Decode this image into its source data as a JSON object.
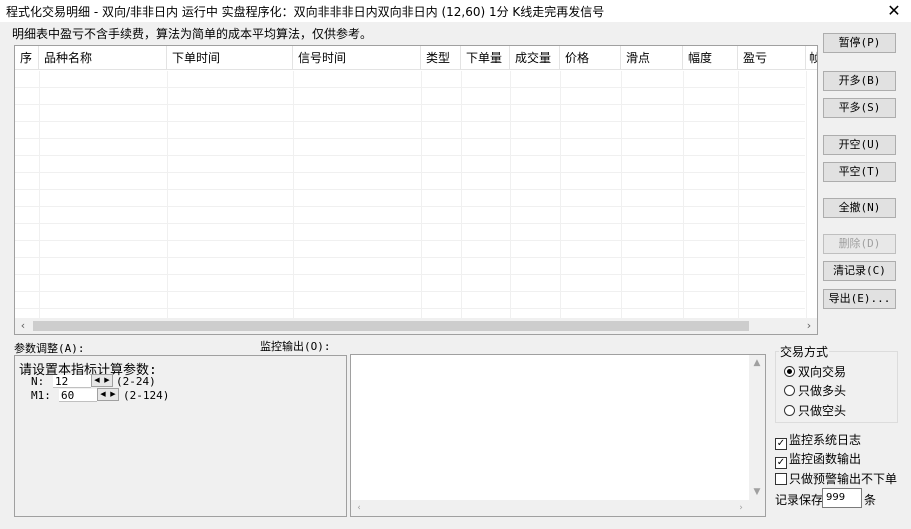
{
  "window": {
    "title": "程式化交易明细 - 双向/非非日内 运行中  实盘程序化：双向非非非日内双向非日内 (12,60) 1分 K线走完再发信号",
    "close_icon": "close-icon"
  },
  "notice": "明细表中盈亏不含手续费，算法为简单的成本平均算法，仅供参考。",
  "table": {
    "columns": [
      "序",
      "品种名称",
      "下单时间",
      "信号时间",
      "类型",
      "下单量",
      "成交量",
      "价格",
      "滑点",
      "幅度",
      "盈亏",
      "帧"
    ],
    "rows": []
  },
  "buttons": {
    "pause": "暂停(P)",
    "open_long": "开多(B)",
    "close_long": "平多(S)",
    "open_short": "开空(U)",
    "close_short": "平空(T)",
    "cancel_all": "全撤(N)",
    "delete": "删除(D)",
    "clear_records": "清记录(C)",
    "export": "导出(E)..."
  },
  "params": {
    "label": "参数调整(A):",
    "hint": "请设置本指标计算参数:",
    "items": [
      {
        "name": "N:",
        "value": "12",
        "range": "(2-24)"
      },
      {
        "name": "M1:",
        "value": "60",
        "range": "(2-124)"
      }
    ]
  },
  "monitor": {
    "label": "监控输出(O):"
  },
  "trade_mode": {
    "label": "交易方式",
    "options": [
      "双向交易",
      "只做多头",
      "只做空头"
    ],
    "selected": "双向交易"
  },
  "checks": [
    {
      "label": "监控系统日志",
      "checked": true
    },
    {
      "label": "监控函数输出",
      "checked": true
    },
    {
      "label": "只做预警输出不下单",
      "checked": false
    }
  ],
  "record_keep": {
    "label": "记录保存",
    "value": "999",
    "unit": "条"
  }
}
